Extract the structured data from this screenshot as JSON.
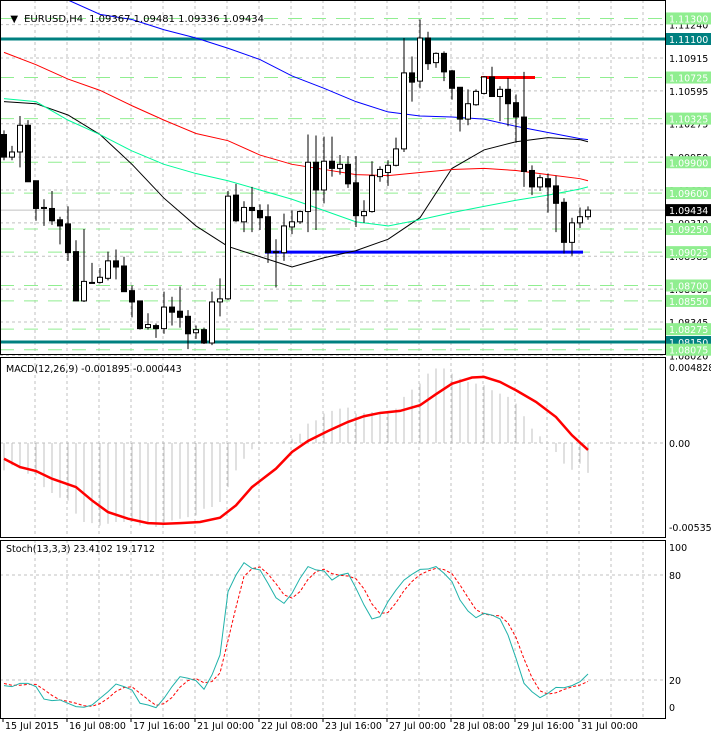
{
  "header": {
    "arrow": "▼",
    "symbol": "EURUSD,H4",
    "ohlc": "1.09367 1.09481 1.09336 1.09434"
  },
  "colors": {
    "bull_fill": "#ffffff",
    "bear_fill": "#000000",
    "grid": "#c0c0c0",
    "teal_level": "#008080",
    "green_level": "#90ee90",
    "blue_level": "#0000ff",
    "red_level": "#ff0000",
    "macd_hist": "#c0c0c0",
    "macd_signal": "#ff0000",
    "stoch_main": "#20b2aa",
    "stoch_signal": "#ff0000"
  },
  "time_axis": {
    "labels": [
      {
        "bar": 0,
        "text": "15 Jul 2015"
      },
      {
        "bar": 8,
        "text": "16 Jul 08:00"
      },
      {
        "bar": 16,
        "text": "17 Jul 16:00"
      },
      {
        "bar": 24,
        "text": "21 Jul 00:00"
      },
      {
        "bar": 32,
        "text": "22 Jul 08:00"
      },
      {
        "bar": 40,
        "text": "23 Jul 16:00"
      },
      {
        "bar": 48,
        "text": "27 Jul 00:00"
      },
      {
        "bar": 56,
        "text": "28 Jul 08:00"
      },
      {
        "bar": 64,
        "text": "29 Jul 16:00"
      },
      {
        "bar": 72,
        "text": "31 Jul 00:00"
      }
    ]
  },
  "chart_data": [
    {
      "type": "candlestick",
      "title": "EURUSD,H4",
      "ylim": [
        1.0803,
        1.1148
      ],
      "grid": true,
      "y_ticks": [
        "1.11240",
        "1.10915",
        "1.10595",
        "1.10275",
        "1.09950",
        "1.09630",
        "1.09310",
        "1.08985",
        "1.08665",
        "1.08345",
        "1.08020"
      ],
      "current_price": "1.09434",
      "candles": [
        [
          1.1017,
          1.1021,
          1.0992,
          1.0995
        ],
        [
          1.0995,
          1.1006,
          1.0992,
          1.1
        ],
        [
          1.1,
          1.1035,
          1.0985,
          1.1026
        ],
        [
          1.1026,
          1.1031,
          1.0971,
          1.0971
        ],
        [
          1.0972,
          1.0972,
          1.0933,
          1.0945
        ],
        [
          1.0946,
          1.0954,
          1.0928,
          1.0945
        ],
        [
          1.0945,
          1.0962,
          1.0929,
          1.0933
        ],
        [
          1.0934,
          1.0937,
          1.091,
          1.0928
        ],
        [
          1.093,
          1.0947,
          1.0894,
          1.0902
        ],
        [
          1.0903,
          1.0914,
          1.0855,
          1.0855
        ],
        [
          1.0855,
          1.0925,
          1.0854,
          1.0874
        ],
        [
          1.0873,
          1.0892,
          1.0872,
          1.0873
        ],
        [
          1.0873,
          1.0887,
          1.0872,
          1.0878
        ],
        [
          1.0877,
          1.0903,
          1.0875,
          1.0894
        ],
        [
          1.0894,
          1.0905,
          1.0876,
          1.0888
        ],
        [
          1.0889,
          1.0898,
          1.0864,
          1.0864
        ],
        [
          1.0865,
          1.087,
          1.0839,
          1.0854
        ],
        [
          1.0855,
          1.0855,
          1.0827,
          1.0828
        ],
        [
          1.0829,
          1.0843,
          1.0827,
          1.0832
        ],
        [
          1.0831,
          1.0833,
          1.0819,
          1.0828
        ],
        [
          1.0828,
          1.0864,
          1.0823,
          1.0849
        ],
        [
          1.0849,
          1.0859,
          1.0831,
          1.0844
        ],
        [
          1.0845,
          1.0869,
          1.0829,
          1.0839
        ],
        [
          1.084,
          1.0846,
          1.0808,
          1.0823
        ],
        [
          1.0824,
          1.0831,
          1.0818,
          1.0827
        ],
        [
          1.0827,
          1.0829,
          1.0813,
          1.0814
        ],
        [
          1.0814,
          1.0864,
          1.0812,
          1.0854
        ],
        [
          1.0854,
          1.0877,
          1.084,
          1.0857
        ],
        [
          1.0857,
          1.0962,
          1.0856,
          1.0957
        ],
        [
          1.0958,
          1.0969,
          1.0932,
          1.0933
        ],
        [
          1.0932,
          1.0952,
          1.0922,
          1.0946
        ],
        [
          1.0946,
          1.0966,
          1.0922,
          1.0943
        ],
        [
          1.0943,
          1.0949,
          1.0924,
          1.0936
        ],
        [
          1.0937,
          1.0949,
          1.0892,
          1.0902
        ],
        [
          1.0903,
          1.0915,
          1.0868,
          1.0902
        ],
        [
          1.0902,
          1.094,
          1.0894,
          1.0928
        ],
        [
          1.0927,
          1.0943,
          1.092,
          1.0932
        ],
        [
          1.0932,
          1.0943,
          1.093,
          1.0942
        ],
        [
          1.0942,
          1.1017,
          1.0922,
          1.099
        ],
        [
          1.099,
          1.1016,
          1.0924,
          1.0963
        ],
        [
          1.0963,
          1.1015,
          1.095,
          1.0991
        ],
        [
          1.0991,
          1.1015,
          1.0976,
          1.0984
        ],
        [
          1.0984,
          1.0997,
          1.0978,
          1.0988
        ],
        [
          1.0988,
          1.0996,
          1.0965,
          1.0969
        ],
        [
          1.097,
          1.0996,
          1.0927,
          1.0938
        ],
        [
          1.0938,
          1.0953,
          1.0931,
          1.0942
        ],
        [
          1.0942,
          1.0991,
          1.0941,
          1.0977
        ],
        [
          1.0976,
          1.0986,
          1.0971,
          1.0983
        ],
        [
          1.098,
          1.0992,
          1.0967,
          1.0987
        ],
        [
          1.0987,
          1.1014,
          1.0986,
          1.1003
        ],
        [
          1.1003,
          1.1111,
          1.1,
          1.1077
        ],
        [
          1.1077,
          1.1093,
          1.1049,
          1.1068
        ],
        [
          1.1069,
          1.1129,
          1.1062,
          1.1111
        ],
        [
          1.1111,
          1.1117,
          1.108,
          1.1086
        ],
        [
          1.1087,
          1.1097,
          1.1082,
          1.1096
        ],
        [
          1.1096,
          1.1098,
          1.1069,
          1.1078
        ],
        [
          1.1079,
          1.108,
          1.1051,
          1.1062
        ],
        [
          1.1063,
          1.1063,
          1.102,
          1.1032
        ],
        [
          1.1032,
          1.1061,
          1.1026,
          1.1047
        ],
        [
          1.1046,
          1.1061,
          1.1045,
          1.1059
        ],
        [
          1.1057,
          1.1074,
          1.1056,
          1.1073
        ],
        [
          1.1073,
          1.1083,
          1.1054,
          1.1054
        ],
        [
          1.1054,
          1.1064,
          1.103,
          1.1061
        ],
        [
          1.1061,
          1.1072,
          1.1025,
          1.1047
        ],
        [
          1.1048,
          1.1056,
          1.1009,
          1.1034
        ],
        [
          1.1034,
          1.1078,
          1.0966,
          1.0981
        ],
        [
          1.0982,
          1.0987,
          1.0958,
          1.0966
        ],
        [
          1.0966,
          1.0978,
          1.0962,
          1.0975
        ],
        [
          1.0974,
          1.0979,
          1.0941,
          1.0966
        ],
        [
          1.0967,
          1.0977,
          1.0922,
          1.095
        ],
        [
          1.0951,
          1.0955,
          1.0901,
          1.0912
        ],
        [
          1.0912,
          1.0936,
          1.0899,
          1.0931
        ],
        [
          1.0931,
          1.0946,
          1.0926,
          1.0937
        ],
        [
          1.0937,
          1.0947,
          1.0934,
          1.09434
        ]
      ],
      "moving_averages": {
        "bars": [
          0,
          4,
          8,
          12,
          16,
          20,
          24,
          28,
          32,
          36,
          40,
          44,
          48,
          52,
          56,
          60,
          64,
          68,
          72,
          73
        ],
        "lines": [
          {
            "color": "#000000",
            "values": [
              1.1049,
              1.1047,
              1.1036,
              1.1017,
              1.0988,
              1.0955,
              1.0928,
              1.0908,
              1.0898,
              1.0888,
              1.0897,
              1.0904,
              1.0915,
              1.0936,
              1.0984,
              1.1002,
              1.101,
              1.1014,
              1.1012,
              1.101
            ]
          },
          {
            "color": "#00fa9a",
            "values": [
              1.1052,
              1.1049,
              1.1031,
              1.1017,
              1.1001,
              1.0988,
              1.0979,
              1.0972,
              1.0963,
              1.0954,
              1.0943,
              1.0932,
              1.0928,
              1.0934,
              1.0941,
              1.0947,
              1.0953,
              1.0958,
              1.0964,
              1.0966
            ]
          },
          {
            "color": "#ff0000",
            "values": [
              1.1097,
              1.1085,
              1.1071,
              1.106,
              1.1045,
              1.1031,
              1.1018,
              1.1011,
              1.0997,
              1.0988,
              1.0983,
              1.0978,
              1.0977,
              1.098,
              1.0983,
              1.0984,
              1.0982,
              1.0978,
              1.0974,
              1.0972
            ]
          },
          {
            "color": "#0000ff",
            "values": [
              null,
              null,
              1.115,
              1.1134,
              1.1129,
              1.1119,
              1.1111,
              1.1101,
              1.109,
              1.1074,
              1.1062,
              1.1049,
              1.1039,
              1.1035,
              1.1034,
              1.1032,
              1.1025,
              1.1019,
              1.1013,
              1.1012
            ]
          }
        ]
      },
      "levels": [
        {
          "price": "1.11300",
          "style": "green-dashed"
        },
        {
          "price": "1.11100",
          "style": "teal"
        },
        {
          "price": "1.10725",
          "style": "green-dashed"
        },
        {
          "price": "1.10325",
          "style": "green-dashed"
        },
        {
          "price": "1.09900",
          "style": "green-dashed"
        },
        {
          "price": "1.09600",
          "style": "green-dashed"
        },
        {
          "price": "1.09250",
          "style": "green-dashed"
        },
        {
          "price": "1.09025",
          "style": "green-dashed"
        },
        {
          "price": "1.08700",
          "style": "green-dashed"
        },
        {
          "price": "1.08550",
          "style": "green-dashed"
        },
        {
          "price": "1.08275",
          "style": "green-dashed"
        },
        {
          "price": "1.08150",
          "style": "teal"
        },
        {
          "price": "1.08075",
          "style": "green-dashed"
        }
      ],
      "segments": [
        {
          "price": 1.09025,
          "from_bar": 33,
          "to_bar": 72,
          "color": "#0000ff"
        },
        {
          "price": 1.10725,
          "from_bar": 60,
          "to_bar": 66,
          "color": "#ff0000"
        }
      ]
    },
    {
      "type": "bar",
      "title": "MACD(12,26,9) -0.001895 -0.000443",
      "ylim": [
        -0.005351,
        0.004828
      ],
      "y_ticks": [
        "0.004828",
        "0.00",
        "-0.005351"
      ],
      "histogram": [
        -0.00174,
        -0.00142,
        -0.00163,
        -0.00195,
        -0.00206,
        -0.0028,
        -0.00318,
        -0.00348,
        -0.00365,
        -0.00449,
        -0.00502,
        -0.00509,
        -0.00524,
        -0.00513,
        -0.00502,
        -0.00502,
        -0.00502,
        -0.00524,
        -0.00517,
        -0.00534,
        -0.00513,
        -0.00492,
        -0.00481,
        -0.00471,
        -0.0046,
        -0.00418,
        -0.00407,
        -0.00375,
        -0.0028,
        -0.00174,
        -0.001,
        -0.0004,
        0,
        0,
        0,
        0.00013,
        0.00028,
        0.00059,
        0.00123,
        0.00144,
        0.00187,
        0.00204,
        0.00218,
        0.00225,
        0.00187,
        0.00191,
        0.00197,
        0.00197,
        0.00204,
        0.00218,
        0.00293,
        0.00339,
        0.00377,
        0.00441,
        0.00473,
        0.00473,
        0.00441,
        0.00409,
        0.00388,
        0.00377,
        0.00367,
        0.00335,
        0.00314,
        0.00293,
        0.0025,
        0.0017,
        0.00091,
        0.00042,
        0,
        -0.00057,
        -0.00131,
        -0.0017,
        -0.00131,
        -0.001895
      ],
      "signal": [
        [
          0,
          -0.001
        ],
        [
          2,
          -0.00153
        ],
        [
          4,
          -0.00178
        ],
        [
          6,
          -0.00227
        ],
        [
          9,
          -0.0028
        ],
        [
          11,
          -0.00365
        ],
        [
          13,
          -0.00439
        ],
        [
          15.5,
          -0.00481
        ],
        [
          18,
          -0.00509
        ],
        [
          20,
          -0.00513
        ],
        [
          22,
          -0.00509
        ],
        [
          24.5,
          -0.00502
        ],
        [
          27,
          -0.00475
        ],
        [
          29,
          -0.00396
        ],
        [
          31,
          -0.0028
        ],
        [
          34,
          -0.00163
        ],
        [
          36,
          -0.00057
        ],
        [
          38,
          0.00013
        ],
        [
          40.5,
          0.00076
        ],
        [
          43,
          0.00134
        ],
        [
          45,
          0.0017
        ],
        [
          47,
          0.00191
        ],
        [
          49.5,
          0.00204
        ],
        [
          52,
          0.0024
        ],
        [
          54,
          0.0031
        ],
        [
          56,
          0.00377
        ],
        [
          58.5,
          0.00416
        ],
        [
          60,
          0.0042
        ],
        [
          62,
          0.00388
        ],
        [
          64,
          0.00335
        ],
        [
          66.5,
          0.00261
        ],
        [
          69,
          0.00165
        ],
        [
          71,
          0.00049
        ],
        [
          73,
          -0.000443
        ]
      ]
    },
    {
      "type": "line",
      "title": "Stoch(13,3,3) 23.4102 19.1712",
      "ylim": [
        0,
        100
      ],
      "y_ticks": [
        "100",
        "80",
        "20",
        "0"
      ],
      "main": [
        16.8,
        16.2,
        18.1,
        18.1,
        16.2,
        9.1,
        8.2,
        8.6,
        6.7,
        4.8,
        4.4,
        5.7,
        9.5,
        13.3,
        17.7,
        16.2,
        14.3,
        6.7,
        5.7,
        4.2,
        9.5,
        16.2,
        21.9,
        21.0,
        19.6,
        14.7,
        22.9,
        34.3,
        70.5,
        80,
        87,
        83.8,
        82.9,
        75.2,
        67,
        63.8,
        69.5,
        78.1,
        84.8,
        82.9,
        82.3,
        77.1,
        80,
        81,
        72.4,
        62.9,
        54.9,
        56.2,
        64.8,
        71.4,
        77.1,
        80.4,
        83.2,
        83.4,
        84.8,
        81,
        76.2,
        65.7,
        59.4,
        55.6,
        58.1,
        57.1,
        54.9,
        45.7,
        32.4,
        18.1,
        13.3,
        9.9,
        12.4,
        15.8,
        15.6,
        16.8,
        19.0,
        23.4102
      ],
      "signal": [
        18,
        17,
        17.0,
        17.5,
        17.5,
        14.5,
        11.2,
        8.6,
        7.8,
        6.7,
        5.3,
        5.0,
        6.5,
        9.5,
        13.5,
        15.7,
        16.1,
        12.4,
        8.9,
        5.5,
        6.5,
        10.0,
        15.9,
        19.7,
        20.8,
        18.4,
        19.1,
        24.0,
        42.6,
        61.6,
        79.2,
        83.6,
        84.6,
        80.6,
        75.0,
        68.7,
        66.8,
        70.5,
        77.5,
        81.9,
        83.3,
        80.8,
        79.8,
        79.4,
        77.8,
        72.1,
        63.4,
        58.0,
        58.6,
        64.1,
        71.1,
        76.3,
        80.2,
        82.3,
        83.8,
        83.1,
        80.7,
        74.3,
        67.1,
        60.2,
        57.7,
        56.9,
        56.7,
        52.6,
        44.3,
        32.1,
        21.3,
        13.8,
        11.9,
        12.7,
        14.6,
        16.1,
        17.1,
        19.1712
      ]
    }
  ]
}
